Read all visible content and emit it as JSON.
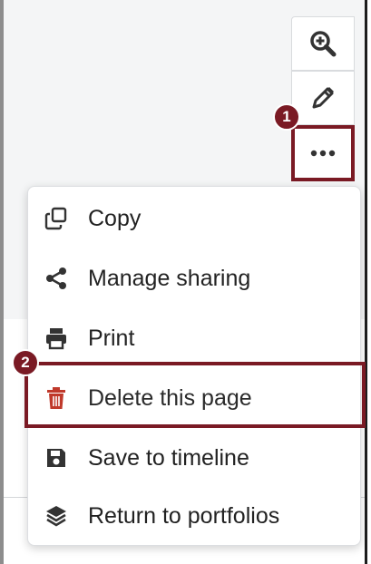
{
  "toolbar": {
    "zoom_icon": "zoom-in-icon",
    "edit_icon": "pencil-icon",
    "more_icon": "ellipsis-icon"
  },
  "badges": {
    "step1": "1",
    "step2": "2"
  },
  "menu": {
    "items": [
      {
        "label": "Copy",
        "icon": "copy-icon"
      },
      {
        "label": "Manage sharing",
        "icon": "share-icon"
      },
      {
        "label": "Print",
        "icon": "print-icon"
      },
      {
        "label": "Delete this page",
        "icon": "trash-icon",
        "color": "#c0392b"
      },
      {
        "label": "Save to timeline",
        "icon": "save-icon"
      },
      {
        "label": "Return to portfolios",
        "icon": "layers-icon"
      }
    ]
  },
  "colors": {
    "highlight": "#7a1a24",
    "delete_icon": "#c0392b"
  }
}
